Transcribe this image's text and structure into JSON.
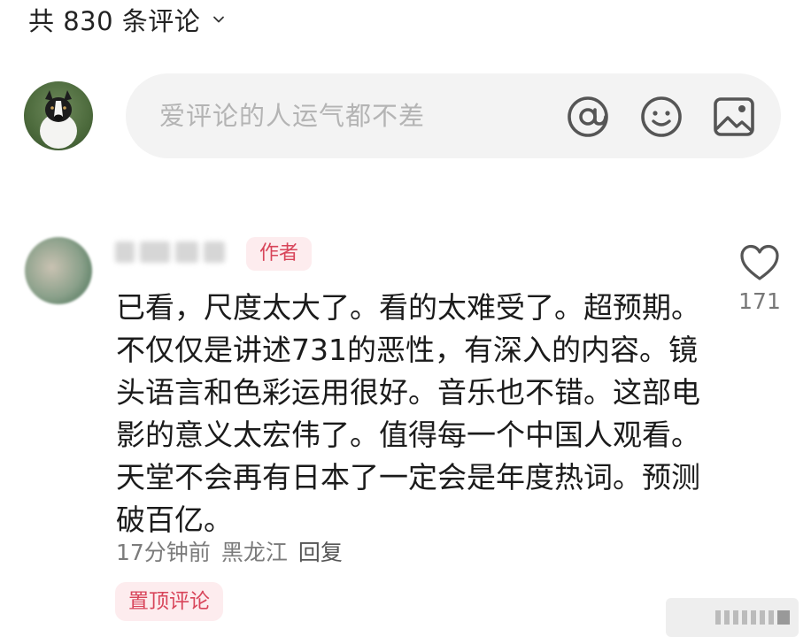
{
  "header": {
    "title": "共 830 条评论"
  },
  "compose": {
    "placeholder": "爱评论的人运气都不差"
  },
  "comment": {
    "author_badge": "作者",
    "text": "已看，尺度太大了。看的太难受了。超预期。不仅仅是讲述731的恶性，有深入的内容。镜头语言和色彩运用很好。音乐也不错。这部电影的意义太宏伟了。值得每一个中国人观看。天堂不会再有日本了一定会是年度热词。预测破百亿。",
    "time": "17分钟前",
    "location": "黑龙江",
    "reply_label": "回复",
    "pinned_label": "置顶评论",
    "like_count": "171"
  },
  "icons": {
    "expand": "chevron-down-icon",
    "mention": "at-icon",
    "emoji": "smiley-icon",
    "image": "image-icon",
    "like": "heart-icon"
  },
  "colors": {
    "accent": "#d8455a",
    "badge_bg": "#fdecee",
    "input_bg": "#f3f3f3",
    "placeholder": "#b4b4b4"
  }
}
